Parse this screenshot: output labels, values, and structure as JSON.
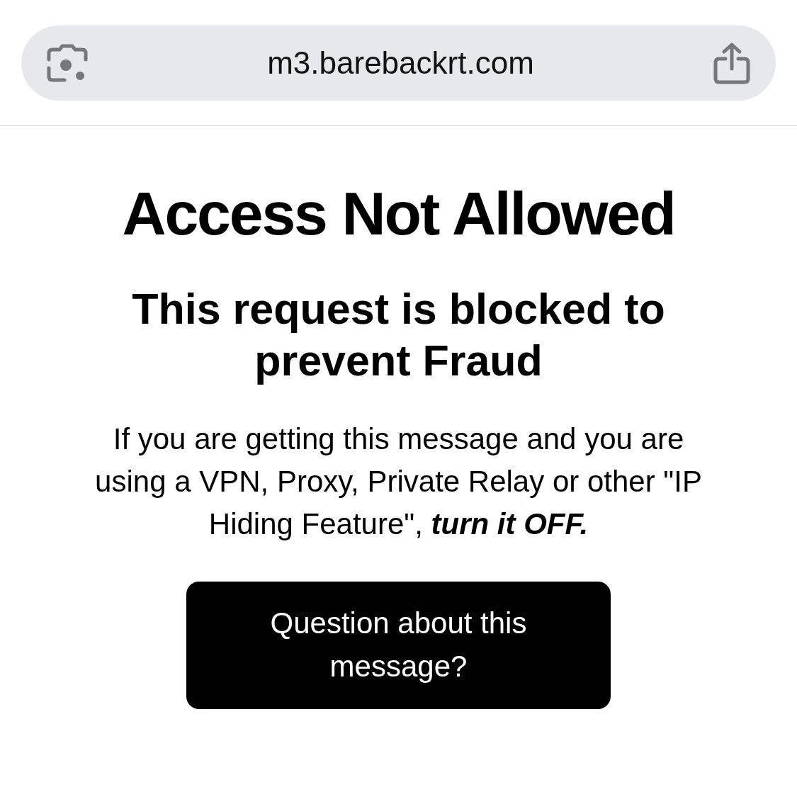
{
  "address_bar": {
    "url": "m3.barebackrt.com"
  },
  "page": {
    "title": "Access Not Allowed",
    "subtitle": "This request is blocked to prevent Fraud",
    "message": "If you are getting this message and you are using a VPN, Proxy, Private Relay or other \"IP Hiding Feature\", **turn it OFF.**",
    "button": "Question about this message?"
  }
}
